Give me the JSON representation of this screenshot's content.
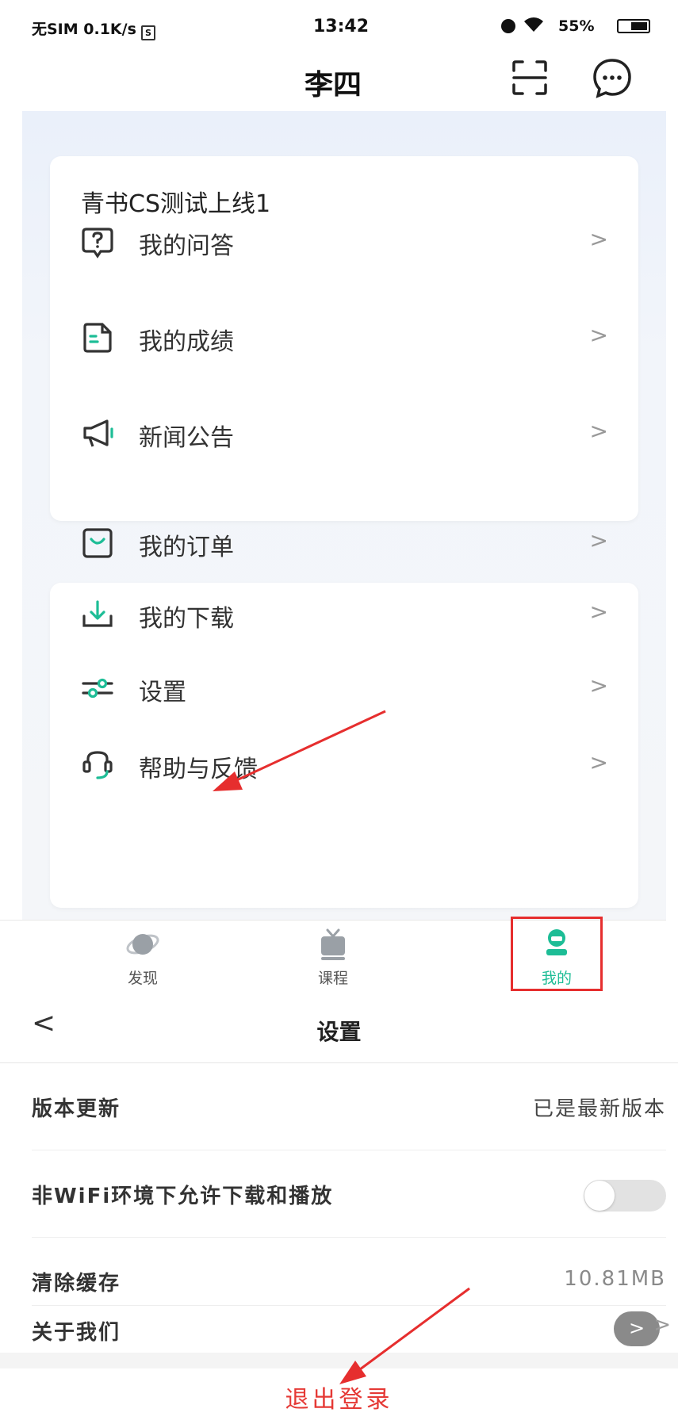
{
  "status_bar": {
    "carrier": "无SIM 0.1K/s",
    "sim_glyph": "S",
    "time": "13:42",
    "battery_percent": "55%",
    "icons": [
      "alarm-icon",
      "wifi-icon",
      "battery-icon"
    ]
  },
  "header": {
    "title": "李四",
    "icons": [
      "scan-icon",
      "chat-bubble-icon"
    ]
  },
  "card1": {
    "title": "青书CS测试上线1",
    "items": [
      {
        "label": "我的问答",
        "icon": "question-icon"
      },
      {
        "label": "我的成绩",
        "icon": "grade-document-icon"
      },
      {
        "label": "新闻公告",
        "icon": "megaphone-icon"
      }
    ]
  },
  "card2": {
    "items": [
      {
        "label": "我的订单",
        "icon": "order-bag-icon"
      },
      {
        "label": "我的下载",
        "icon": "download-icon"
      },
      {
        "label": "设置",
        "icon": "settings-sliders-icon"
      },
      {
        "label": "帮助与反馈",
        "icon": "help-feedback-icon"
      }
    ]
  },
  "chevron": ">",
  "tab_bar": {
    "tabs": [
      {
        "label": "发现",
        "icon": "planet-icon",
        "active": false
      },
      {
        "label": "课程",
        "icon": "tv-icon",
        "active": false
      },
      {
        "label": "我的",
        "icon": "profile-icon",
        "active": true
      }
    ]
  },
  "settings_screen": {
    "back": "<",
    "title": "设置",
    "rows": [
      {
        "label": "版本更新",
        "value": "已是最新版本"
      },
      {
        "label": "非WiFi环境下允许下载和播放",
        "toggle_on": false
      },
      {
        "label": "清除缓存",
        "value": "10.81MB"
      },
      {
        "label": "关于我们",
        "button": ">",
        "chevron": ">"
      }
    ],
    "logout": "退出登录"
  },
  "colors": {
    "accent": "#1dbd96",
    "annotation_red": "#e62e2e",
    "logout_red": "#e53935",
    "header_bg": "#eaf0fa"
  }
}
